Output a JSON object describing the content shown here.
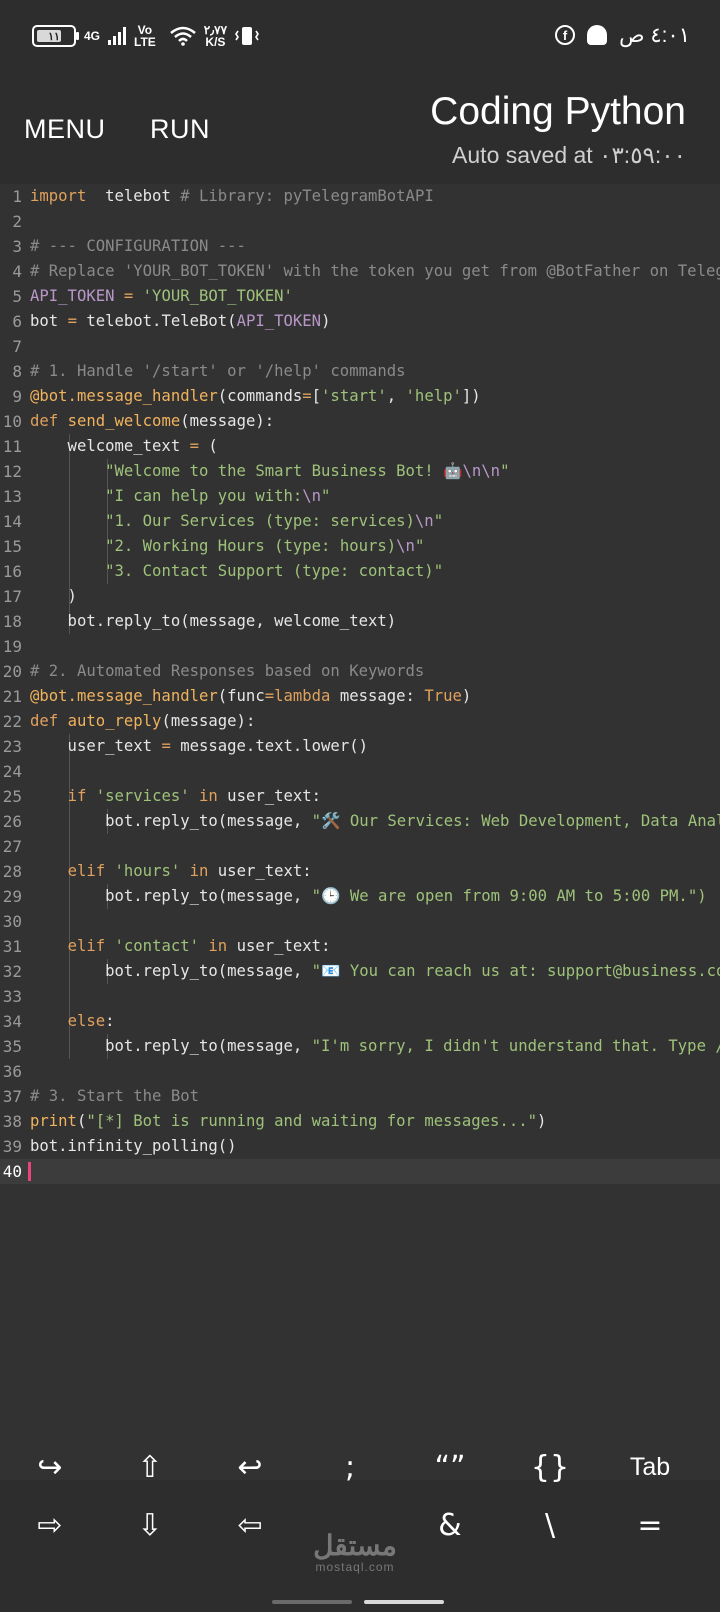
{
  "status_bar": {
    "battery": "١١",
    "network": "4G",
    "volte_top": "Vo",
    "volte_bottom": "LTE",
    "speed_top": "٢٫٧٧",
    "speed_bottom": "K/S",
    "clock": "٤:٠١ ص",
    "facebook_glyph": "f"
  },
  "header": {
    "menu_label": "MENU",
    "run_label": "RUN",
    "title": "Coding Python",
    "subtitle": "Auto saved at ٠٣:٥٩:٠٠"
  },
  "editor": {
    "line_numbers": [
      "1",
      "2",
      "3",
      "4",
      "5",
      "6",
      "7",
      "8",
      "9",
      "10",
      "11",
      "12",
      "13",
      "14",
      "15",
      "16",
      "17",
      "18",
      "19",
      "20",
      "21",
      "22",
      "23",
      "24",
      "25",
      "26",
      "27",
      "28",
      "29",
      "30",
      "31",
      "32",
      "33",
      "34",
      "35",
      "36",
      "37",
      "38",
      "39",
      "40"
    ],
    "current_line": "40",
    "lines": [
      [
        [
          "kw",
          "import"
        ],
        [
          "",
          "  telebot "
        ],
        [
          "cm",
          "# Library: pyTelegramBotAPI"
        ]
      ],
      [],
      [
        [
          "cm",
          "# --- CONFIGURATION ---"
        ]
      ],
      [
        [
          "cm",
          "# Replace 'YOUR_BOT_TOKEN' with the token you get from @BotFather on Telegram"
        ]
      ],
      [
        [
          "cst",
          "API_TOKEN"
        ],
        [
          "op",
          " = "
        ],
        [
          "str",
          "'YOUR_BOT_TOKEN'"
        ]
      ],
      [
        [
          "",
          "bot "
        ],
        [
          "op",
          "="
        ],
        [
          "",
          " telebot.TeleBot("
        ],
        [
          "cst",
          "API_TOKEN"
        ],
        [
          "",
          ")"
        ]
      ],
      [],
      [
        [
          "cm",
          "# 1. Handle '/start' or '/help' commands"
        ]
      ],
      [
        [
          "fn",
          "@bot.message_handler"
        ],
        [
          "",
          "(commands"
        ],
        [
          "op",
          "="
        ],
        [
          "",
          "["
        ],
        [
          "str",
          "'start'"
        ],
        [
          "",
          ", "
        ],
        [
          "str",
          "'help'"
        ],
        [
          "",
          "])"
        ]
      ],
      [
        [
          "kw",
          "def"
        ],
        [
          "",
          " "
        ],
        [
          "fn",
          "send_welcome"
        ],
        [
          "",
          "(message):"
        ]
      ],
      [
        [
          "",
          "    welcome_text "
        ],
        [
          "op",
          "="
        ],
        [
          "",
          " ("
        ]
      ],
      [
        [
          "",
          "        "
        ],
        [
          "str",
          "\"Welcome to the Smart Business Bot! 🤖"
        ],
        [
          "cst",
          "\\n\\n"
        ],
        [
          "str",
          "\""
        ]
      ],
      [
        [
          "",
          "        "
        ],
        [
          "str",
          "\"I can help you with:"
        ],
        [
          "cst",
          "\\n"
        ],
        [
          "str",
          "\""
        ]
      ],
      [
        [
          "",
          "        "
        ],
        [
          "str",
          "\"1. Our Services (type: services)"
        ],
        [
          "cst",
          "\\n"
        ],
        [
          "str",
          "\""
        ]
      ],
      [
        [
          "",
          "        "
        ],
        [
          "str",
          "\"2. Working Hours (type: hours)"
        ],
        [
          "cst",
          "\\n"
        ],
        [
          "str",
          "\""
        ]
      ],
      [
        [
          "",
          "        "
        ],
        [
          "str",
          "\"3. Contact Support (type: contact)\""
        ]
      ],
      [
        [
          "",
          "    )"
        ]
      ],
      [
        [
          "",
          "    bot.reply_to(message, welcome_text)"
        ]
      ],
      [],
      [
        [
          "cm",
          "# 2. Automated Responses based on Keywords"
        ]
      ],
      [
        [
          "fn",
          "@bot.message_handler"
        ],
        [
          "",
          "(func"
        ],
        [
          "op",
          "="
        ],
        [
          "kw",
          "lambda"
        ],
        [
          "",
          " message: "
        ],
        [
          "kw",
          "True"
        ],
        [
          "",
          ")"
        ]
      ],
      [
        [
          "kw",
          "def"
        ],
        [
          "",
          " "
        ],
        [
          "fn",
          "auto_reply"
        ],
        [
          "",
          "(message):"
        ]
      ],
      [
        [
          "",
          "    user_text "
        ],
        [
          "op",
          "="
        ],
        [
          "",
          " message.text.lower()"
        ]
      ],
      [],
      [
        [
          "",
          "    "
        ],
        [
          "kw",
          "if"
        ],
        [
          "",
          " "
        ],
        [
          "str",
          "'services'"
        ],
        [
          "",
          " "
        ],
        [
          "kw",
          "in"
        ],
        [
          "",
          " user_text:"
        ]
      ],
      [
        [
          "",
          "        bot.reply_to(message, "
        ],
        [
          "str",
          "\"🛠️ Our Services: Web Development, Data Analysis\")"
        ]
      ],
      [],
      [
        [
          "",
          "    "
        ],
        [
          "kw",
          "elif"
        ],
        [
          "",
          " "
        ],
        [
          "str",
          "'hours'"
        ],
        [
          "",
          " "
        ],
        [
          "kw",
          "in"
        ],
        [
          "",
          " user_text:"
        ]
      ],
      [
        [
          "",
          "        bot.reply_to(message, "
        ],
        [
          "str",
          "\"🕒 We are open from 9:00 AM to 5:00 PM.\")"
        ]
      ],
      [],
      [
        [
          "",
          "    "
        ],
        [
          "kw",
          "elif"
        ],
        [
          "",
          " "
        ],
        [
          "str",
          "'contact'"
        ],
        [
          "",
          " "
        ],
        [
          "kw",
          "in"
        ],
        [
          "",
          " user_text:"
        ]
      ],
      [
        [
          "",
          "        bot.reply_to(message, "
        ],
        [
          "str",
          "\"📧 You can reach us at: support@business.com\")"
        ]
      ],
      [],
      [
        [
          "",
          "    "
        ],
        [
          "kw",
          "else"
        ],
        [
          "",
          ":"
        ]
      ],
      [
        [
          "",
          "        bot.reply_to(message, "
        ],
        [
          "str",
          "\"I'm sorry, I didn't understand that. Type /help\")"
        ]
      ],
      [],
      [
        [
          "cm",
          "# 3. Start the Bot"
        ]
      ],
      [
        [
          "fn",
          "print"
        ],
        [
          "",
          "("
        ],
        [
          "str",
          "\"[*] Bot is running and waiting for messages...\""
        ],
        [
          "",
          ")"
        ]
      ],
      [
        [
          "",
          "bot.infinity_polling()"
        ]
      ],
      []
    ]
  },
  "keys": {
    "row1": [
      "↪",
      "⇧",
      "↩",
      ";",
      "“”",
      "{}",
      "Tab"
    ],
    "row2": [
      "⇨",
      "⇩",
      "⇦",
      "",
      "&",
      "\\",
      "="
    ]
  },
  "watermark": {
    "arabic": "مستقل",
    "latin": "mostaql.com"
  }
}
